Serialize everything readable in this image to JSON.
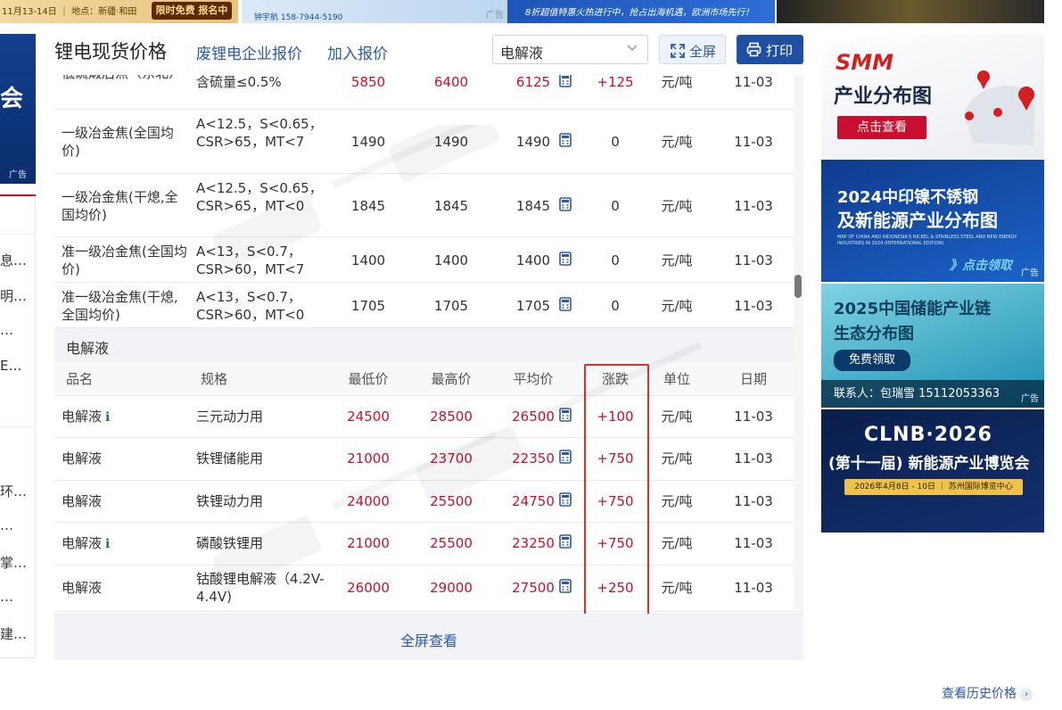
{
  "top_banners": {
    "b1_text": "11月13-14日 ｜ 地点：新疆·和田",
    "b1_button": "限时免费 报名中",
    "b2_text": "钟宇航 158-7944-5190",
    "b2_ad": "广告",
    "b3_text": "8折超值特惠火热进行中，抢占出海机遇，欧洲市场先行！"
  },
  "left": {
    "ad_text": "会",
    "ad_label": "广告",
    "items": [
      "息…",
      "明…",
      "…",
      "E…",
      "环…",
      "…",
      "掌…",
      "…",
      "建…"
    ]
  },
  "header": {
    "title": "锂电现货价格",
    "links": [
      "废锂电企业报价",
      "加入报价"
    ],
    "select_value": "电解液",
    "fullscreen_label": "全屏",
    "print_label": "打印"
  },
  "upper_rows": [
    {
      "name": "低硫煅后焦（东北）",
      "spec": "含硫量≤0.5%",
      "low": "5850",
      "high": "6400",
      "avg": "6125",
      "change": "+125",
      "unit": "元/吨",
      "date": "11-03",
      "red": true
    },
    {
      "name": "一级冶金焦(全国均价)",
      "spec": "A<12.5，S<0.65，CSR>65，MT<7",
      "low": "1490",
      "high": "1490",
      "avg": "1490",
      "change": "0",
      "unit": "元/吨",
      "date": "11-03",
      "red": false
    },
    {
      "name": "一级冶金焦(干熄,全国均价)",
      "spec": "A<12.5，S<0.65，CSR>65，MT<0",
      "low": "1845",
      "high": "1845",
      "avg": "1845",
      "change": "0",
      "unit": "元/吨",
      "date": "11-03",
      "red": false
    },
    {
      "name": "准一级冶金焦(全国均价)",
      "spec": "A<13，S<0.7，CSR>60，MT<7",
      "low": "1400",
      "high": "1400",
      "avg": "1400",
      "change": "0",
      "unit": "元/吨",
      "date": "11-03",
      "red": false
    },
    {
      "name": "准一级冶金焦(干熄,全国均价)",
      "spec": "A<13，S<0.7，CSR>60，MT<0",
      "low": "1705",
      "high": "1705",
      "avg": "1705",
      "change": "0",
      "unit": "元/吨",
      "date": "11-03",
      "red": false
    }
  ],
  "section_title": "电解液",
  "columns": {
    "name": "品名",
    "spec": "规格",
    "low": "最低价",
    "high": "最高价",
    "avg": "平均价",
    "change": "涨跌",
    "unit": "单位",
    "date": "日期"
  },
  "rows": [
    {
      "name": "电解液",
      "info": true,
      "spec": "三元动力用",
      "low": "24500",
      "high": "28500",
      "avg": "26500",
      "change": "+100",
      "unit": "元/吨",
      "date": "11-03"
    },
    {
      "name": "电解液",
      "info": false,
      "spec": "铁锂储能用",
      "low": "21000",
      "high": "23700",
      "avg": "22350",
      "change": "+750",
      "unit": "元/吨",
      "date": "11-03"
    },
    {
      "name": "电解液",
      "info": false,
      "spec": "铁锂动力用",
      "low": "24000",
      "high": "25500",
      "avg": "24750",
      "change": "+750",
      "unit": "元/吨",
      "date": "11-03"
    },
    {
      "name": "电解液",
      "info": true,
      "spec": "磷酸铁锂用",
      "low": "21000",
      "high": "25500",
      "avg": "23250",
      "change": "+750",
      "unit": "元/吨",
      "date": "11-03"
    },
    {
      "name": "电解液",
      "info": false,
      "spec": "钴酸锂电解液（4.2V-4.4V)",
      "low": "26000",
      "high": "29000",
      "avg": "27500",
      "change": "+250",
      "unit": "元/吨",
      "date": "11-03"
    }
  ],
  "fullview_label": "全屏查看",
  "history_label": "查看历史价格",
  "right_ads": {
    "ad1_logo": "SMM",
    "ad1_title": "产业分布图",
    "ad1_button": "点击查看",
    "ad2_title1": "2024中印镍不锈钢",
    "ad2_title2": "及新能源产业分布图",
    "ad2_sub": "MAP OF CHINA AND INDONESIA'S NICKEL & STAINLESS STEEL AND NEW ENERGY INDUSTRIES IN 2024 (INTERNATIONAL EDITION)",
    "ad2_button": "》点击领取",
    "ad3_title1": "2025中国储能产业链",
    "ad3_title2": "生态分布图",
    "ad3_button": "免费领取",
    "ad3_contact": "联系人：包瑞雪 15112053363",
    "ad4_title": "CLNB·2026",
    "ad4_sub": "(第十一届) 新能源产业博览会",
    "ad4_bar": "2026年4月8日 - 10日 ｜ 苏州国际博览中心",
    "ad_label": "广告"
  },
  "colors": {
    "accent": "#1f4fa2",
    "link": "#2d5aa8",
    "price_red": "#c8102e",
    "highlight": "#e0302a"
  }
}
